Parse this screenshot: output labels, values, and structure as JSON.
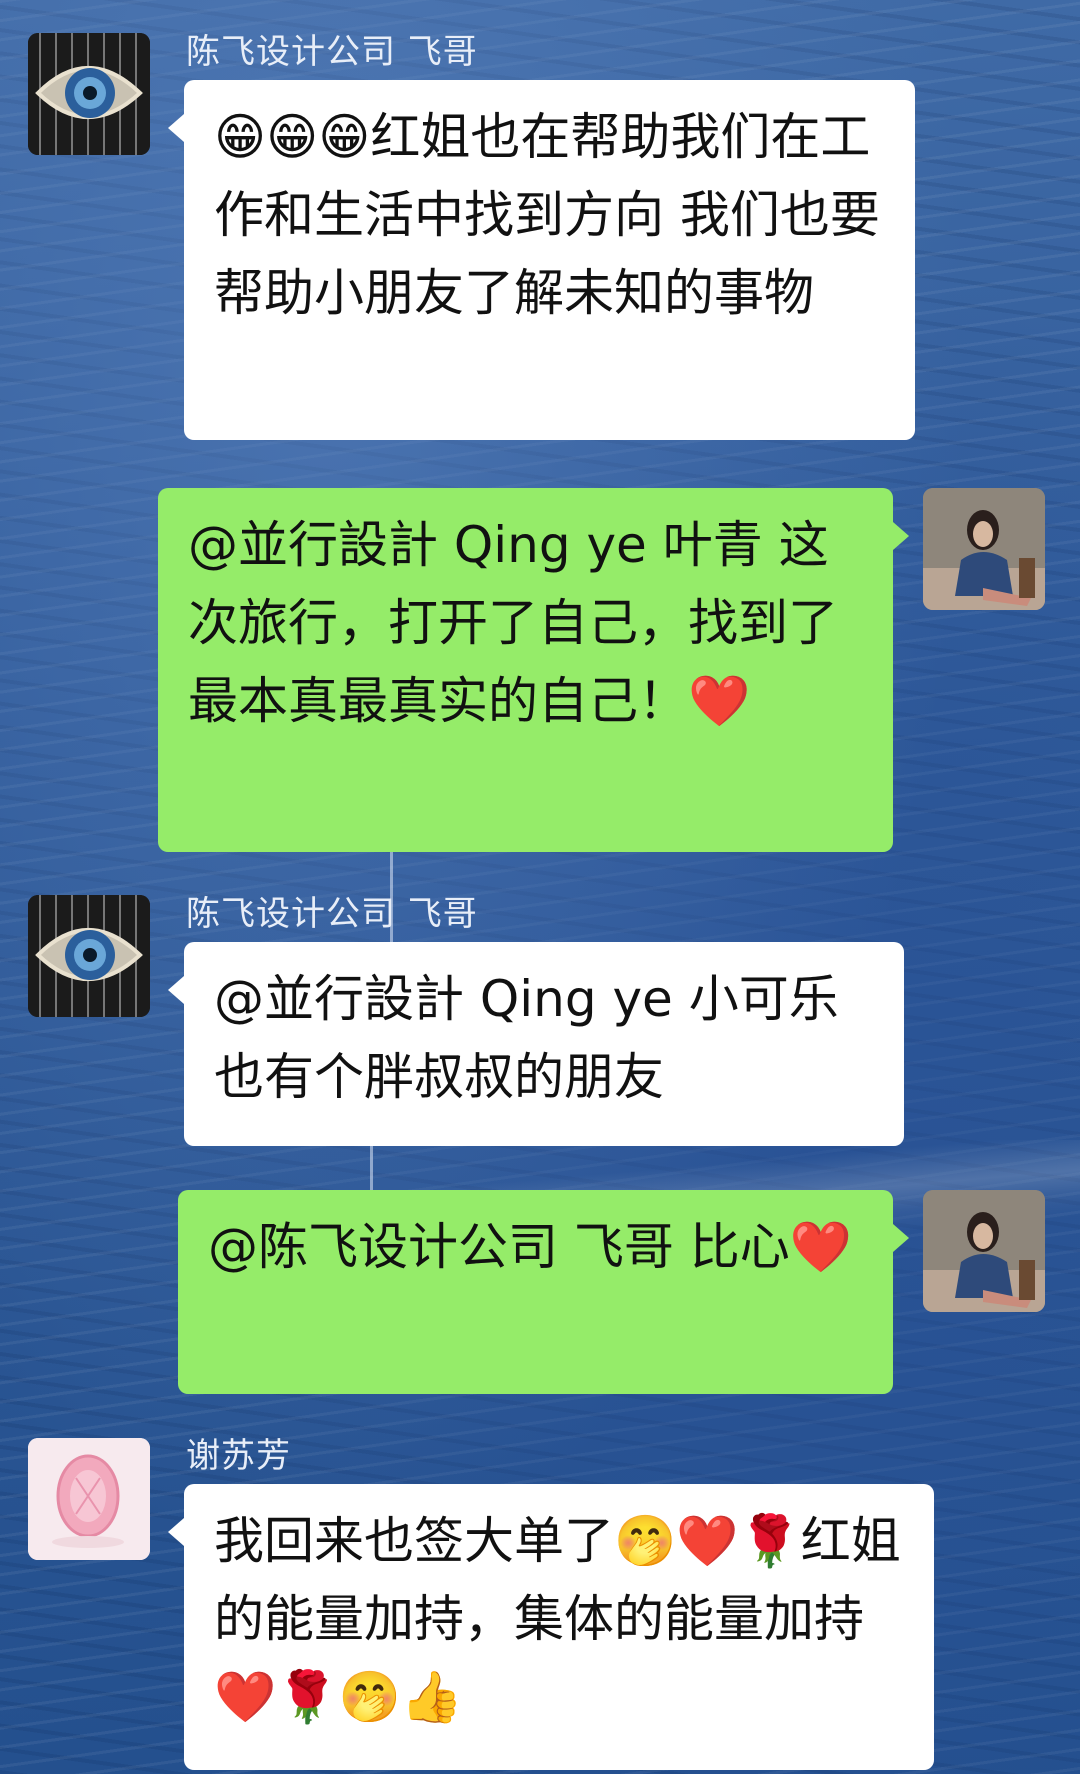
{
  "messages": [
    {
      "sender": "陈飞设计公司  飞哥",
      "text": "😁😁😁红姐也在帮助我们在工作和生活中找到方向 我们也要帮助小朋友了解未知的事物",
      "avatar": "eye-art-avatar",
      "side": "left"
    },
    {
      "sender": "",
      "text": "@並行設計 Qing ye 叶青 这次旅行，打开了自己，找到了最本真最真实的自己！❤️",
      "avatar": "woman-avatar",
      "side": "right"
    },
    {
      "sender": "陈飞设计公司  飞哥",
      "text": "@並行設計 Qing ye 小可乐也有个胖叔叔的朋友",
      "avatar": "eye-art-avatar",
      "side": "left"
    },
    {
      "sender": "",
      "text": "@陈飞设计公司  飞哥 比心❤️",
      "avatar": "woman-avatar",
      "side": "right"
    },
    {
      "sender": "谢苏芳",
      "text": "我回来也签大单了🤭❤️🌹红姐的能量加持，集体的能量加持❤️🌹🤭👍",
      "avatar": "pink-gem-avatar",
      "side": "left"
    }
  ],
  "colors": {
    "bubble_incoming": "#ffffff",
    "bubble_outgoing": "#95ec69",
    "background": "#2f5a99"
  }
}
